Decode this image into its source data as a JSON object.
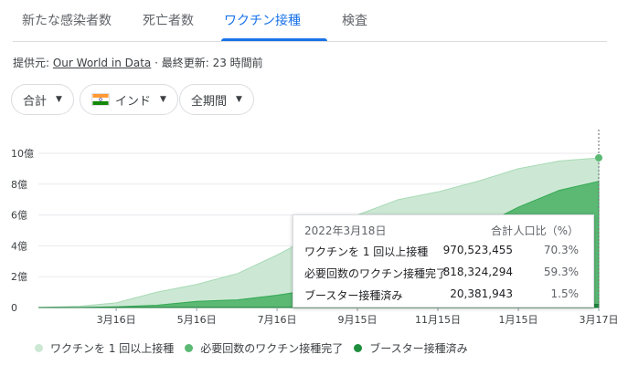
{
  "tabs": [
    {
      "label": "新たな感染者数"
    },
    {
      "label": "死亡者数"
    },
    {
      "label": "ワクチン接種"
    },
    {
      "label": "検査"
    }
  ],
  "source": {
    "prefix": "提供元: ",
    "link_text": "Our World in Data",
    "updated": " · 最終更新: 23 時間前"
  },
  "filters": {
    "metric": "合計",
    "country": "インド",
    "period": "全期間"
  },
  "tooltip": {
    "date": "2022年3月18日",
    "col_total": "合計",
    "col_pct": "人口比（%）",
    "rows": [
      {
        "label": "ワクチンを 1 回以上接種",
        "total": "970,523,455",
        "pct": "70.3%"
      },
      {
        "label": "必要回数のワクチン接種完了",
        "total": "818,324,294",
        "pct": "59.3%"
      },
      {
        "label": "ブースター接種済み",
        "total": "20,381,943",
        "pct": "1.5%"
      }
    ]
  },
  "colors": {
    "accent": "#1a73e8",
    "series_one_dose": "#cce8d4",
    "series_fully": "#5bb974",
    "series_booster": "#1e8e3e"
  },
  "chart_data": {
    "type": "area",
    "x_dates": [
      "2021-01-16",
      "2021-02-16",
      "2021-03-16",
      "2021-04-16",
      "2021-05-16",
      "2021-06-16",
      "2021-07-16",
      "2021-08-16",
      "2021-09-15",
      "2021-10-16",
      "2021-11-15",
      "2021-12-16",
      "2022-01-15",
      "2022-02-15",
      "2022-03-17"
    ],
    "xtick_labels": [
      "3月16日",
      "5月16日",
      "7月16日",
      "9月15日",
      "11月15日",
      "1月15日",
      "3月17日"
    ],
    "xtick_dates": [
      "2021-03-16",
      "2021-05-16",
      "2021-07-16",
      "2021-09-15",
      "2021-11-15",
      "2022-01-15",
      "2022-03-17"
    ],
    "ytick_labels": [
      "0",
      "2億",
      "4億",
      "6億",
      "8億",
      "10億"
    ],
    "ylim": [
      0,
      1000000000
    ],
    "series": [
      {
        "name": "ワクチンを 1 回以上接種",
        "values": [
          0,
          8000000,
          30000000,
          100000000,
          150000000,
          220000000,
          340000000,
          480000000,
          600000000,
          700000000,
          750000000,
          820000000,
          900000000,
          950000000,
          970523455
        ]
      },
      {
        "name": "必要回数のワクチン接種完了",
        "values": [
          0,
          0,
          5000000,
          15000000,
          40000000,
          50000000,
          80000000,
          120000000,
          200000000,
          300000000,
          400000000,
          520000000,
          650000000,
          760000000,
          818324294
        ]
      },
      {
        "name": "ブースター接種済み",
        "values": [
          0,
          0,
          0,
          0,
          0,
          0,
          0,
          0,
          0,
          0,
          0,
          0,
          5000000,
          15000000,
          20381943
        ]
      }
    ]
  }
}
